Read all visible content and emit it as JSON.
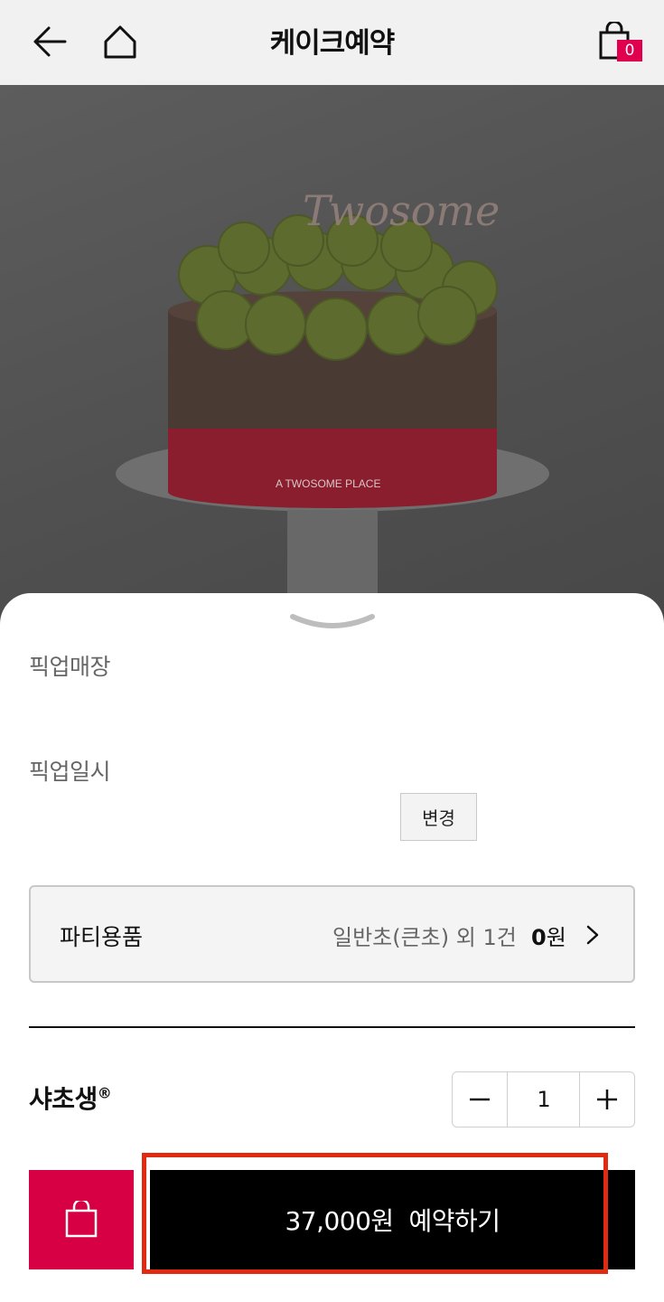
{
  "header": {
    "title": "케이크예약",
    "cart_count": "0",
    "icons": [
      "back-arrow-icon",
      "home-icon",
      "shopping-bag-icon"
    ]
  },
  "hero": {
    "brand_text": "Twosome",
    "ribbon_text": "A TWOSOME PLACE"
  },
  "sheet": {
    "pickup_store_label": "픽업매장",
    "pickup_datetime_label": "픽업일시",
    "change_button": "변경",
    "party_goods": {
      "label": "파티용품",
      "summary": "일반초(큰초) 외 1건",
      "price_number": "0",
      "price_unit": "원"
    },
    "product": {
      "name": "샤초생",
      "mark": "®",
      "quantity": "1"
    },
    "reserve_button": "37,000원  예약하기"
  },
  "colors": {
    "accent_red": "#d70044",
    "badge_pink": "#e0004d",
    "highlight_red": "#e02a12",
    "primary_black": "#000000"
  }
}
